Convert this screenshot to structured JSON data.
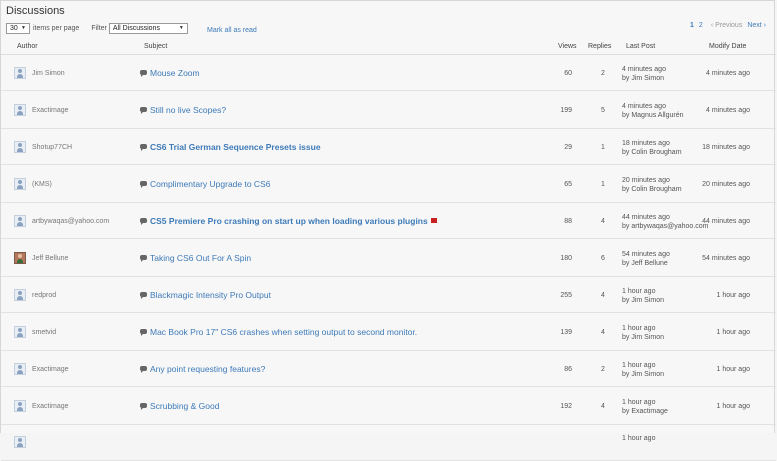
{
  "header": {
    "title": "Discussions"
  },
  "controls": {
    "per_page_value": "30",
    "per_page_label": "items per page",
    "filter_label": "Filter",
    "filter_value": "All Discussions",
    "mark_all": "Mark all as read"
  },
  "pager": {
    "page1": "1",
    "page2": "2",
    "previous": "‹ Previous",
    "next": "Next ›"
  },
  "columns": {
    "author": "Author",
    "subject": "Subject",
    "views": "Views",
    "replies": "Replies",
    "last_post": "Last Post",
    "modify_date": "Modify Date"
  },
  "rows": [
    {
      "author": "Jim Simon",
      "subject": "Mouse Zoom",
      "views": "60",
      "replies": "2",
      "last_time": "4 minutes ago",
      "last_by": "by Jim Simon",
      "modified": "4 minutes ago"
    },
    {
      "author": "Exactimage",
      "subject": "Still no live Scopes?",
      "views": "199",
      "replies": "5",
      "last_time": "4 minutes ago",
      "last_by": "by Magnus Allgurén",
      "modified": "4 minutes ago"
    },
    {
      "author": "Shotup77CH",
      "subject": "CS6 Trial German Sequence Presets issue",
      "views": "29",
      "replies": "1",
      "last_time": "18 minutes ago",
      "last_by": "by Colin Brougham",
      "modified": "18 minutes ago"
    },
    {
      "author": "(KMS)",
      "subject": "Complimentary Upgrade to CS6",
      "views": "65",
      "replies": "1",
      "last_time": "20 minutes ago",
      "last_by": "by Colin Brougham",
      "modified": "20 minutes ago"
    },
    {
      "author": "artbywaqas@yahoo.com",
      "subject": "CS5 Premiere Pro crashing on start up when loading various plugins",
      "views": "88",
      "replies": "4",
      "last_time": "44 minutes ago",
      "last_by": "by artbywaqas@yahoo.com",
      "modified": "44 minutes ago"
    },
    {
      "author": "Jeff Bellune",
      "subject": "Taking CS6 Out For A Spin",
      "views": "180",
      "replies": "6",
      "last_time": "54 minutes ago",
      "last_by": "by Jeff Bellune",
      "modified": "54 minutes ago"
    },
    {
      "author": "redprod",
      "subject": "Blackmagic Intensity Pro Output",
      "views": "255",
      "replies": "4",
      "last_time": "1 hour ago",
      "last_by": "by Jim Simon",
      "modified": "1 hour ago"
    },
    {
      "author": "smetvid",
      "subject": "Mac Book Pro 17\" CS6 crashes when setting output to second monitor.",
      "views": "139",
      "replies": "4",
      "last_time": "1 hour ago",
      "last_by": "by Jim Simon",
      "modified": "1 hour ago"
    },
    {
      "author": "Exactimage",
      "subject": "Any point requesting features?",
      "views": "86",
      "replies": "2",
      "last_time": "1 hour ago",
      "last_by": "by Jim Simon",
      "modified": "1 hour ago"
    },
    {
      "author": "Exactimage",
      "subject": "Scrubbing & Good",
      "views": "192",
      "replies": "4",
      "last_time": "1 hour ago",
      "last_by": "by Exactimage",
      "modified": "1 hour ago"
    },
    {
      "author": "",
      "subject": "",
      "views": "",
      "replies": "",
      "last_time": "1 hour ago",
      "last_by": "",
      "modified": ""
    }
  ]
}
